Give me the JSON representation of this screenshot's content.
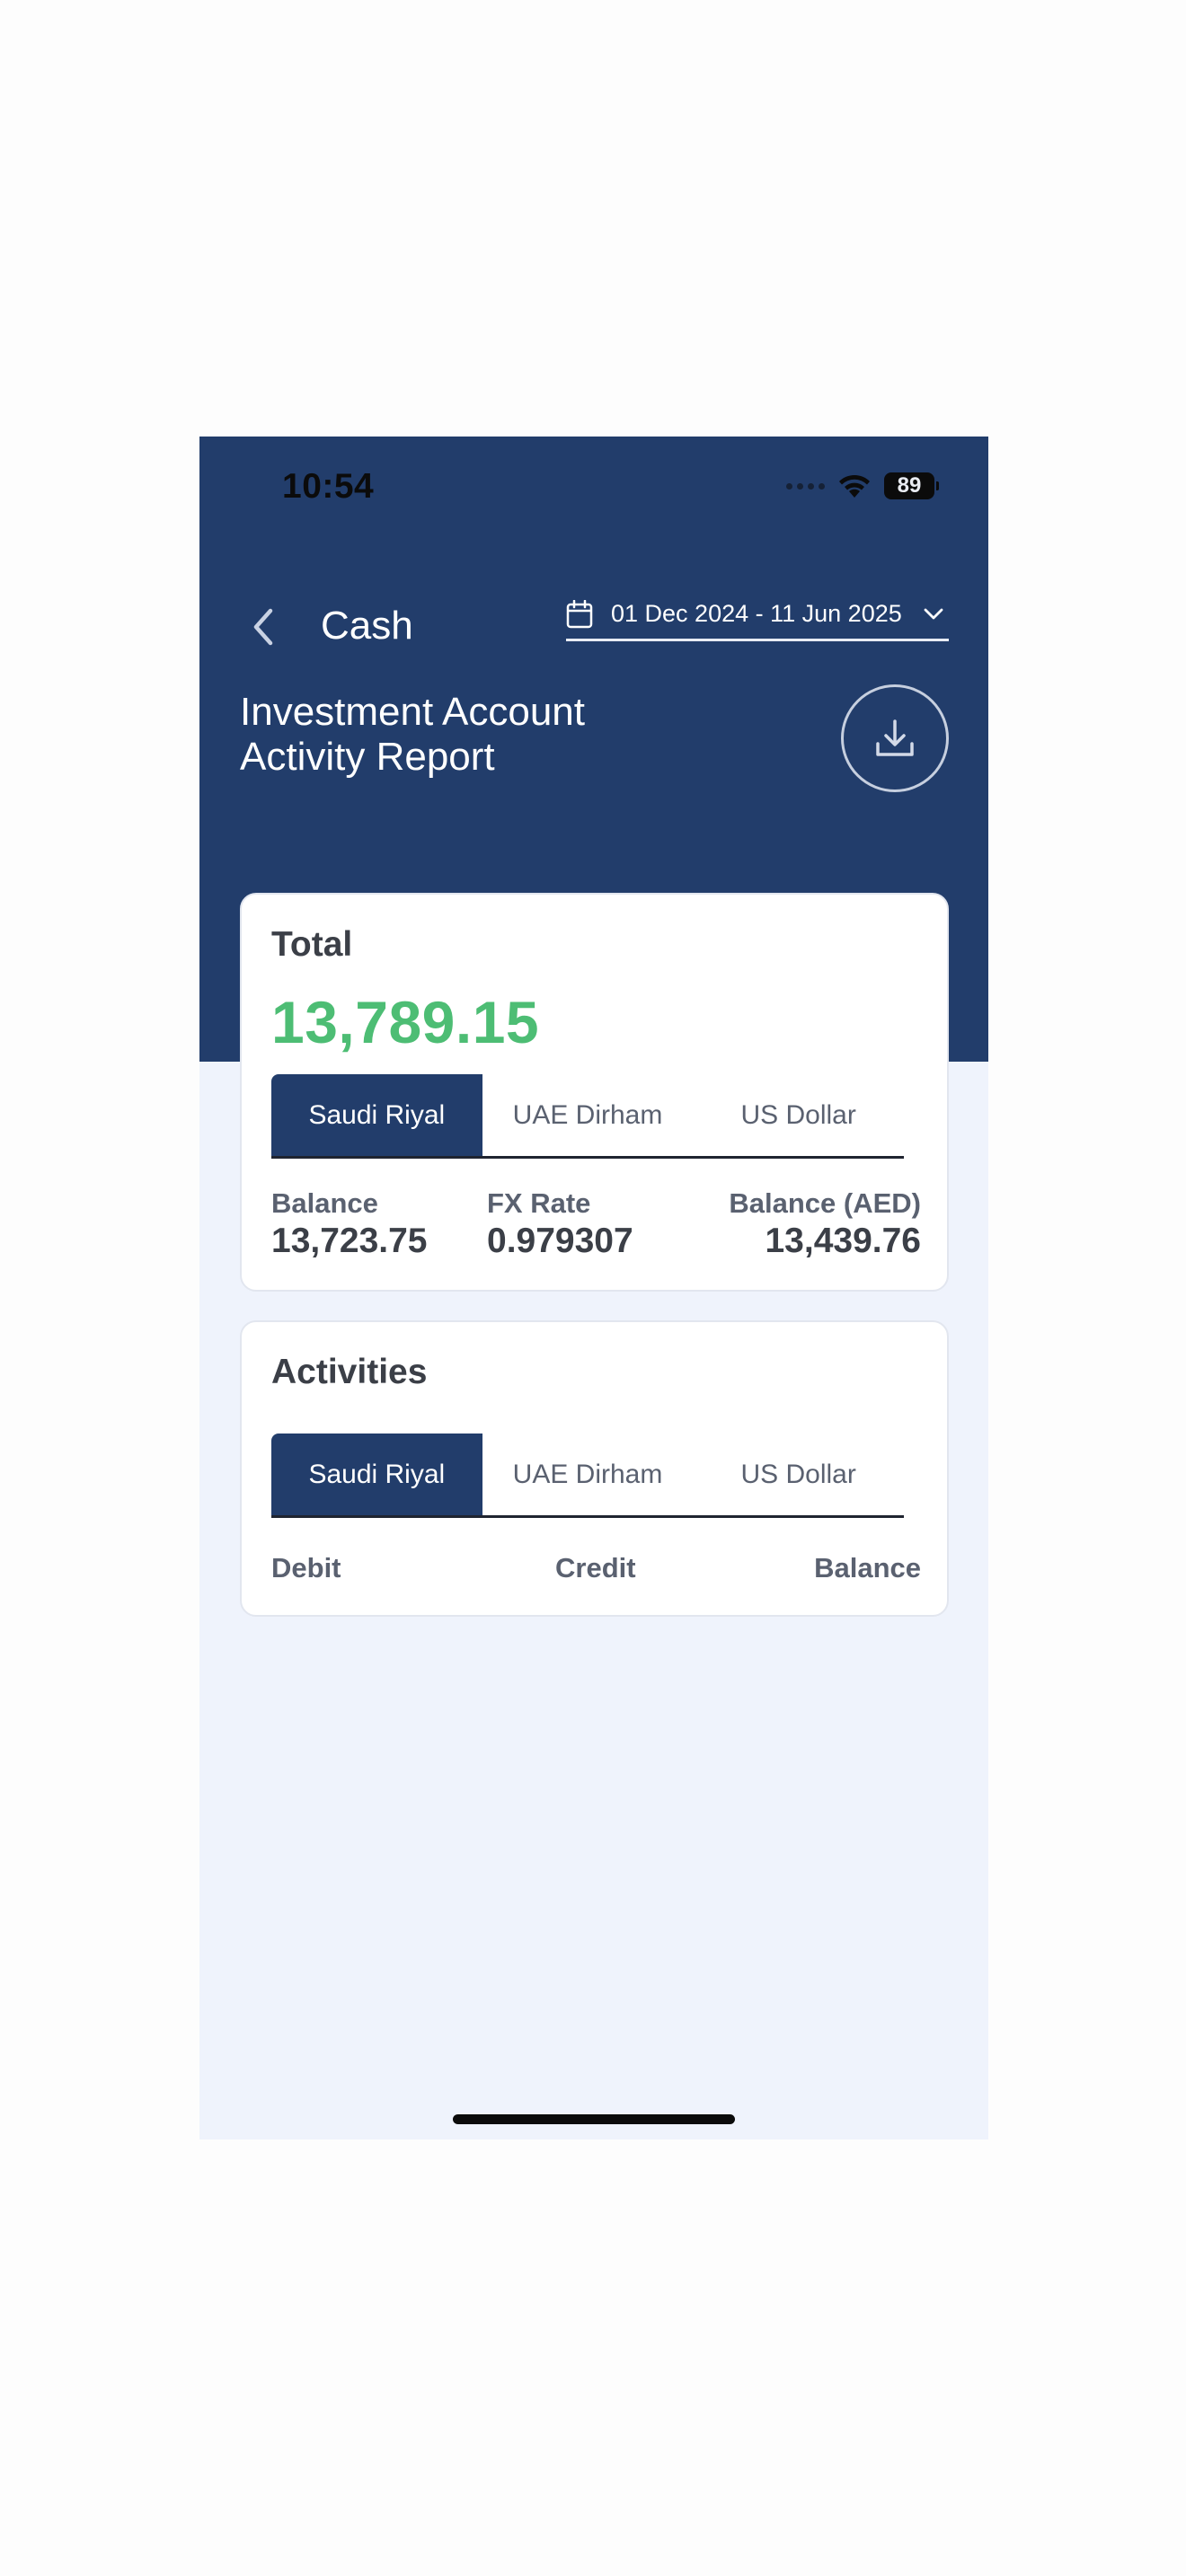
{
  "status_bar": {
    "time": "10:54",
    "battery": "89"
  },
  "nav": {
    "title": "Cash",
    "date_range": "01 Dec 2024 - 11 Jun 2025"
  },
  "report": {
    "title_line1": "Investment Account",
    "title_line2": "Activity Report"
  },
  "total_card": {
    "heading": "Total",
    "amount": "13,789.15",
    "tabs": [
      "Saudi Riyal",
      "UAE Dirham",
      "US Dollar"
    ],
    "active_tab": "Saudi Riyal",
    "stats": {
      "balance_label": "Balance",
      "balance_value": "13,723.75",
      "fx_label": "FX Rate",
      "fx_value": "0.979307",
      "balance_aed_label": "Balance (AED)",
      "balance_aed_value": "13,439.76"
    }
  },
  "activities_card": {
    "heading": "Activities",
    "tabs": [
      "Saudi Riyal",
      "UAE Dirham",
      "US Dollar"
    ],
    "active_tab": "Saudi Riyal",
    "columns": [
      "Debit",
      "Credit",
      "Balance"
    ]
  },
  "colors": {
    "header_bg": "#223d6b",
    "page_bg": "#eff3fc",
    "total_amount": "#4dbd74",
    "active_tab": "#223d6b"
  },
  "icons": {
    "back": "chevron-left-icon",
    "calendar": "calendar-icon",
    "dropdown": "chevron-down-icon",
    "download": "download-icon",
    "wifi": "wifi-icon",
    "battery": "battery-icon"
  }
}
